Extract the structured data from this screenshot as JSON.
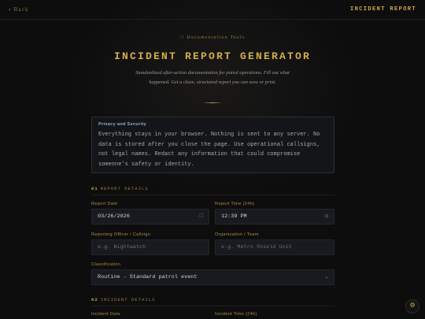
{
  "topbar": {
    "back_arrow": "‹",
    "back_label": "Back",
    "brand": "INCIDENT REPORT"
  },
  "hero": {
    "eyebrow": "// Documentation Tools",
    "title": "INCIDENT REPORT GENERATOR",
    "subtitle": "Standardized after-action documentation for patrol operations. Fill out what happened. Get a clean, structured report you can save or print."
  },
  "privacy": {
    "title": "Privacy and Security",
    "text": "Everything stays in your browser. Nothing is sent to any server. No data is stored after you close the page. Use operational callsigns, not legal names. Redact any information that could compromise someone's safety or identity."
  },
  "sections": [
    {
      "num": "01",
      "label": "REPORT DETAILS"
    },
    {
      "num": "02",
      "label": "INCIDENT DETAILS"
    }
  ],
  "fields": {
    "report_date": {
      "label": "Report Date",
      "value": "03/26/2026",
      "icon": "calendar-icon"
    },
    "report_time": {
      "label": "Report Time (24h)",
      "value": "12:39 PM",
      "icon": "clock-icon"
    },
    "officer": {
      "label": "Reporting Officer / Callsign",
      "placeholder": "e.g. Nightwatch"
    },
    "organization": {
      "label": "Organization / Team",
      "placeholder": "e.g. Metro Shield Unit"
    },
    "classification": {
      "label": "Classification",
      "value": "Routine - Standard patrol event",
      "icon": "chevron-down-icon"
    },
    "incident_date": {
      "label": "Incident Date"
    },
    "incident_time": {
      "label": "Incident Time (24h)"
    }
  },
  "colors": {
    "accent": "#d6ad4d",
    "background": "#0d0d0e",
    "field": "#181a20",
    "privacy_title": "#8db0d0"
  }
}
